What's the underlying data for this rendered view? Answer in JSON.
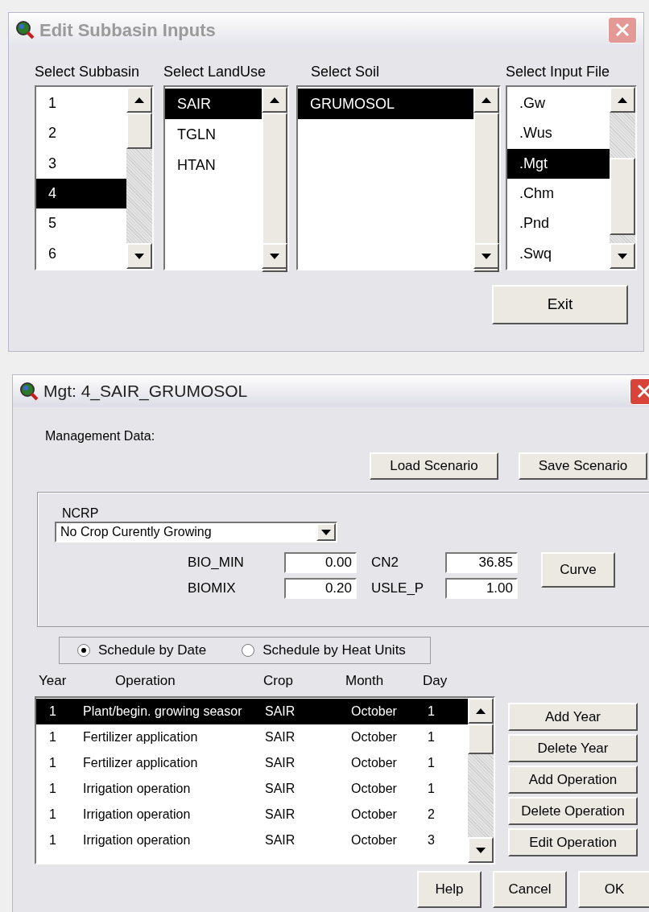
{
  "subbasin_window": {
    "title": "Edit Subbasin Inputs",
    "lists": [
      {
        "label": "Select Subbasin",
        "items": [
          {
            "text": "1",
            "selected": false
          },
          {
            "text": "2",
            "selected": false
          },
          {
            "text": "3",
            "selected": false
          },
          {
            "text": "4",
            "selected": true
          },
          {
            "text": "5",
            "selected": false
          },
          {
            "text": "6",
            "selected": false
          }
        ]
      },
      {
        "label": "Select LandUse",
        "items": [
          {
            "text": "SAIR",
            "selected": true
          },
          {
            "text": "TGLN",
            "selected": false
          },
          {
            "text": "HTAN",
            "selected": false
          }
        ]
      },
      {
        "label": "Select Soil",
        "items": [
          {
            "text": "GRUMOSOL",
            "selected": true
          }
        ]
      },
      {
        "label": "Select Input File",
        "items": [
          {
            "text": ".Gw",
            "selected": false
          },
          {
            "text": ".Wus",
            "selected": false
          },
          {
            "text": ".Mgt",
            "selected": true
          },
          {
            "text": ".Chm",
            "selected": false
          },
          {
            "text": ".Pnd",
            "selected": false
          },
          {
            "text": ".Swq",
            "selected": false
          }
        ]
      }
    ],
    "exit_button": "Exit"
  },
  "mgt_window": {
    "title": "Mgt: 4_SAIR_GRUMOSOL",
    "section_label": "Management Data:",
    "scenario_buttons": [
      "Load Scenario",
      "Save Scenario"
    ],
    "ncrp": {
      "label": "NCRP",
      "value": "No Crop Curently Growing"
    },
    "fields": [
      {
        "label": "BIO_MIN",
        "value": "0.00"
      },
      {
        "label": "CN2",
        "value": "36.85"
      },
      {
        "label": "BIOMIX",
        "value": "0.20"
      },
      {
        "label": "USLE_P",
        "value": "1.00"
      }
    ],
    "curve_button": "Curve",
    "schedule_options": [
      {
        "label": "Schedule by Date",
        "selected": true
      },
      {
        "label": "Schedule by Heat Units",
        "selected": false
      }
    ],
    "table": {
      "columns": [
        "Year",
        "Operation",
        "Crop",
        "Month",
        "Day"
      ],
      "rows": [
        {
          "cells": [
            "1",
            "Plant/begin. growing seasor",
            "SAIR",
            "October",
            "1"
          ],
          "selected": true
        },
        {
          "cells": [
            "1",
            "Fertilizer application",
            "SAIR",
            "October",
            "1"
          ],
          "selected": false
        },
        {
          "cells": [
            "1",
            "Fertilizer application",
            "SAIR",
            "October",
            "1"
          ],
          "selected": false
        },
        {
          "cells": [
            "1",
            "Irrigation operation",
            "SAIR",
            "October",
            "1"
          ],
          "selected": false
        },
        {
          "cells": [
            "1",
            "Irrigation operation",
            "SAIR",
            "October",
            "2"
          ],
          "selected": false
        },
        {
          "cells": [
            "1",
            "Irrigation operation",
            "SAIR",
            "October",
            "3"
          ],
          "selected": false
        }
      ]
    },
    "side_buttons": [
      "Add Year",
      "Delete Year",
      "Add Operation",
      "Delete Operation",
      "Edit Operation"
    ],
    "footer_buttons": [
      "Help",
      "Cancel",
      "OK"
    ]
  }
}
